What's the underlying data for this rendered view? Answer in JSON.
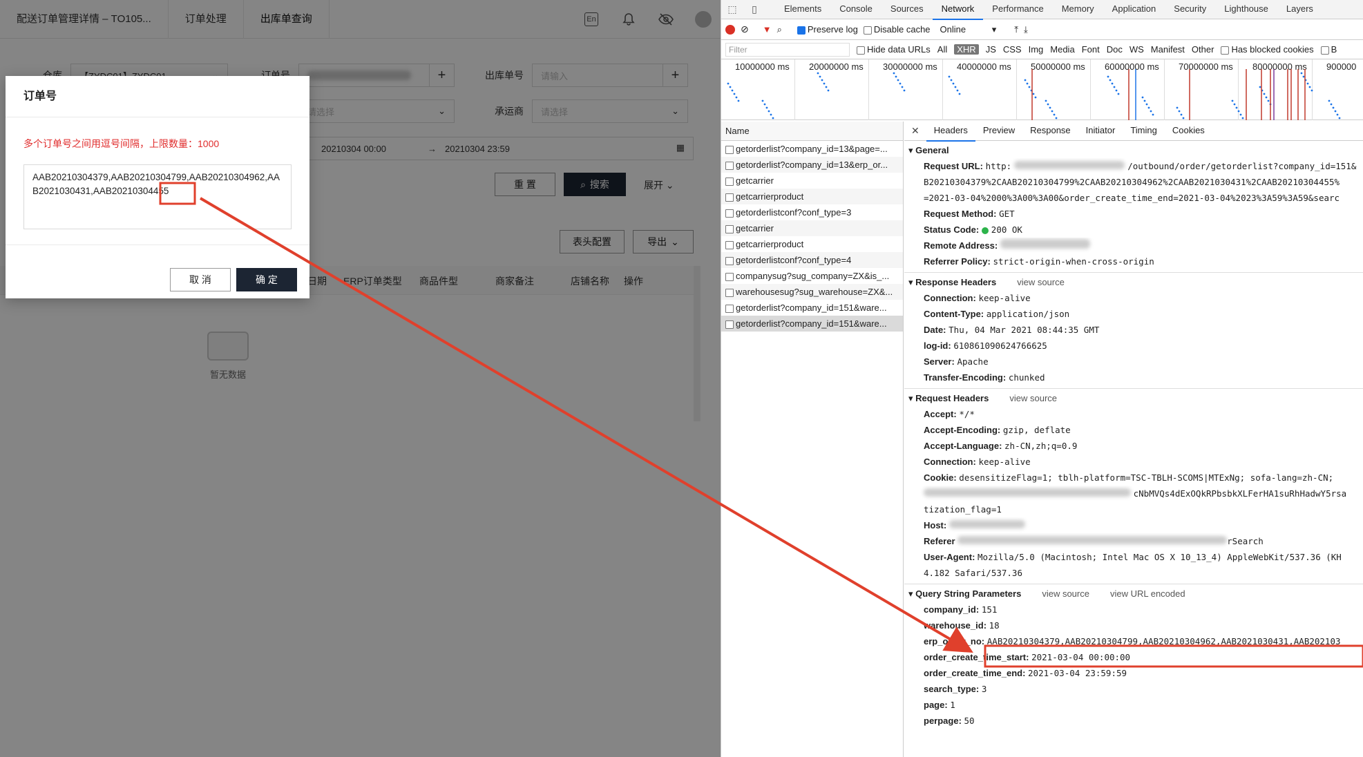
{
  "app": {
    "tabs": [
      "配送订单管理详情 – TO105...",
      "订单处理",
      "出库单查询"
    ],
    "lang_badge": "En",
    "form": {
      "warehouse_label": "仓库",
      "warehouse_value": "【ZYDC01】ZYDC01",
      "order_no_label": "订单号",
      "outbound_no_label": "出库单号",
      "outbound_no_placeholder": "请输入",
      "select_placeholder": "请选择",
      "carrier_label": "承运商",
      "carrier_placeholder": "请选择",
      "date_start": "20210304 00:00",
      "date_sep": "→",
      "date_end": "20210304 23:59"
    },
    "buttons": {
      "reset": "重 置",
      "search": "搜索",
      "expand": "展开",
      "table_config": "表头配置",
      "export": "导出"
    },
    "table_headers": [
      "日期",
      "ERP订单类型",
      "商品件型",
      "商家备注",
      "店铺名称",
      "操作"
    ],
    "empty_text": "暂无数据",
    "modal": {
      "title": "订单号",
      "hint": "多个订单号之间用逗号间隔，上限数量：1000",
      "textarea_value": "AAB20210304379,AAB20210304799,AAB20210304962,AAB2021030431,AAB20210304455",
      "cancel": "取 消",
      "ok": "确 定"
    }
  },
  "devtools": {
    "tabs": [
      "Elements",
      "Console",
      "Sources",
      "Network",
      "Performance",
      "Memory",
      "Application",
      "Security",
      "Lighthouse",
      "Layers"
    ],
    "active_tab": "Network",
    "toolbar": {
      "preserve_log": "Preserve log",
      "disable_cache": "Disable cache",
      "throttle": "Online"
    },
    "filter": {
      "placeholder": "Filter",
      "hide_data_urls": "Hide data URLs",
      "types": [
        "All",
        "XHR",
        "JS",
        "CSS",
        "Img",
        "Media",
        "Font",
        "Doc",
        "WS",
        "Manifest",
        "Other"
      ],
      "has_blocked": "Has blocked cookies",
      "blocked_req": "B"
    },
    "overview_labels": [
      "10000000 ms",
      "20000000 ms",
      "30000000 ms",
      "40000000 ms",
      "50000000 ms",
      "60000000 ms",
      "70000000 ms",
      "80000000 ms",
      "900000"
    ],
    "name_header": "Name",
    "requests": [
      "getorderlist?company_id=13&page=...",
      "getorderlist?company_id=13&erp_or...",
      "getcarrier",
      "getcarrierproduct",
      "getorderlistconf?conf_type=3",
      "getcarrier",
      "getcarrierproduct",
      "getorderlistconf?conf_type=4",
      "companysug?sug_company=ZX&is_...",
      "warehousesug?sug_warehouse=ZX&...",
      "getorderlist?company_id=151&ware...",
      "getorderlist?company_id=151&ware..."
    ],
    "detail_tabs": [
      "Headers",
      "Preview",
      "Response",
      "Initiator",
      "Timing",
      "Cookies"
    ],
    "general": {
      "title": "General",
      "request_url_label": "Request URL:",
      "request_url_value": "http:",
      "request_url_value2": "/outbound/order/getorderlist?company_id=151&",
      "request_url_line2": "B20210304379%2CAAB20210304799%2CAAB20210304962%2CAAB2021030431%2CAAB20210304455%",
      "request_url_line3": "=2021-03-04%2000%3A00%3A00&order_create_time_end=2021-03-04%2023%3A59%3A59&searc",
      "method_label": "Request Method:",
      "method_value": "GET",
      "status_label": "Status Code:",
      "status_value": "200  OK",
      "remote_label": "Remote Address:",
      "referrer_label": "Referrer Policy:",
      "referrer_value": "strict-origin-when-cross-origin"
    },
    "response_headers": {
      "title": "Response Headers",
      "view_source": "view source",
      "items": [
        {
          "k": "Connection:",
          "v": "keep-alive"
        },
        {
          "k": "Content-Type:",
          "v": "application/json"
        },
        {
          "k": "Date:",
          "v": "Thu, 04 Mar 2021 08:44:35 GMT"
        },
        {
          "k": "log-id:",
          "v": "610861090624766625"
        },
        {
          "k": "Server:",
          "v": "Apache"
        },
        {
          "k": "Transfer-Encoding:",
          "v": "chunked"
        }
      ]
    },
    "request_headers": {
      "title": "Request Headers",
      "view_source": "view source",
      "accept_k": "Accept:",
      "accept_v": "*/*",
      "enc_k": "Accept-Encoding:",
      "enc_v": "gzip, deflate",
      "lang_k": "Accept-Language:",
      "lang_v": "zh-CN,zh;q=0.9",
      "conn_k": "Connection:",
      "conn_v": "keep-alive",
      "cookie_k": "Cookie:",
      "cookie_v": "desensitizeFlag=1; tblh-platform=TSC-TBLH-SCOMS|MTExNg; sofa-lang=zh-CN; ",
      "cookie_v2": "cNbMVQs4dExOQkRPbsbkXLFerHA1suRhHadwY5rsa",
      "cookie_v3": "tization_flag=1",
      "host_k": "Host:",
      "referer_k": "Referer",
      "referer_tail": "rSearch",
      "ua_k": "User-Agent:",
      "ua_v": "Mozilla/5.0 (Macintosh; Intel Mac OS X 10_13_4) AppleWebKit/537.36 (KH",
      "ua_v2": "4.182 Safari/537.36"
    },
    "query": {
      "title": "Query String Parameters",
      "view_source": "view source",
      "view_url_encoded": "view URL encoded",
      "items": [
        {
          "k": "company_id:",
          "v": "151"
        },
        {
          "k": "warehouse_id:",
          "v": "18"
        },
        {
          "k": "erp_order_no:",
          "v": "AAB20210304379,AAB20210304799,AAB20210304962,AAB2021030431,AAB202103"
        },
        {
          "k": "order_create_time_start:",
          "v": "2021-03-04 00:00:00"
        },
        {
          "k": "order_create_time_end:",
          "v": "2021-03-04 23:59:59"
        },
        {
          "k": "search_type:",
          "v": "3"
        },
        {
          "k": "page:",
          "v": "1"
        },
        {
          "k": "perpage:",
          "v": "50"
        }
      ]
    }
  },
  "colors": {
    "annotation_red": "#e0402c",
    "primary_dark": "#1c2533",
    "hint_red": "#e02c2c"
  }
}
